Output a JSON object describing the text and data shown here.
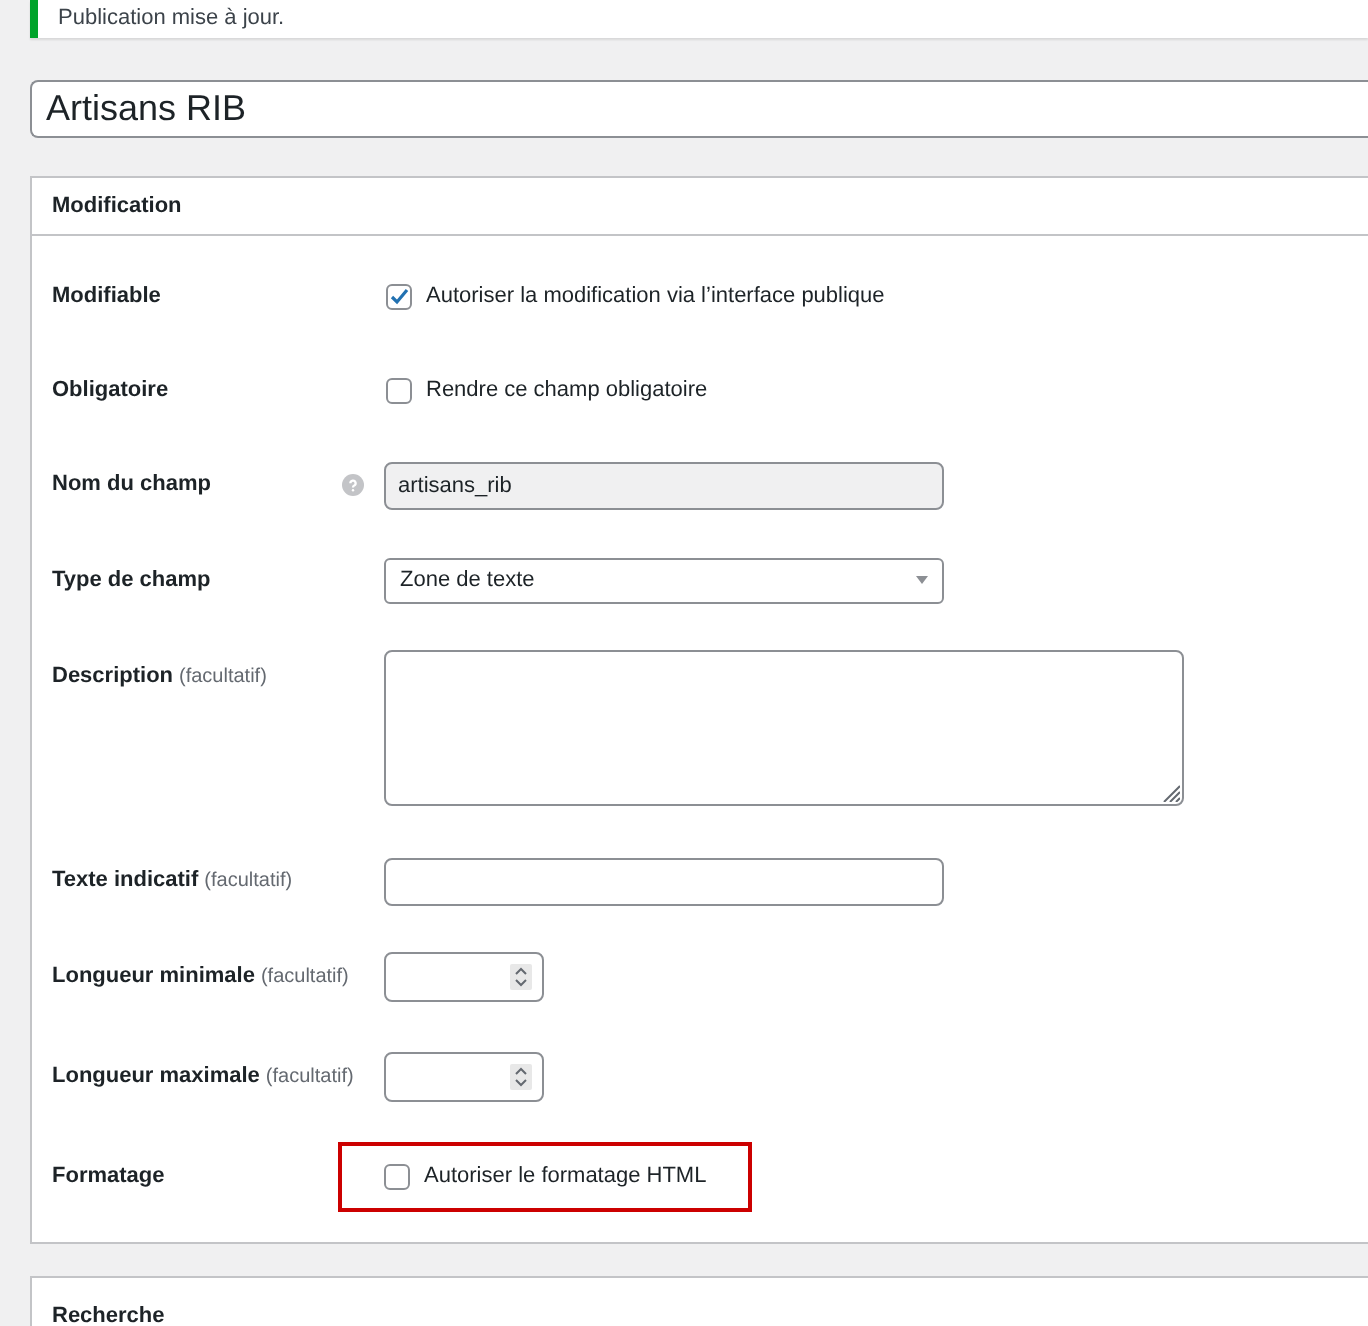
{
  "notice": {
    "text": "Publication mise à jour."
  },
  "title_field": {
    "value": "Artisans RIB"
  },
  "panel": {
    "title": "Modification",
    "rows": [
      {
        "kind": "checkbox",
        "label": "Modifiable",
        "checked": true,
        "text": "Autoriser la modification via l’interface publique",
        "highlighted": false
      },
      {
        "kind": "checkbox",
        "label": "Obligatoire",
        "checked": false,
        "text": "Rendre ce champ obligatoire",
        "highlighted": false
      },
      {
        "kind": "readonly",
        "label": "Nom du champ",
        "value": "artisans_rib"
      },
      {
        "kind": "select",
        "label": "Type de champ",
        "value": "Zone de texte"
      },
      {
        "kind": "textarea",
        "label": "Description",
        "optional": "(facultatif)"
      },
      {
        "kind": "text",
        "label": "Texte indicatif",
        "optional": "(facultatif)"
      },
      {
        "kind": "number",
        "label": "Longueur minimale",
        "optional": "(facultatif)"
      },
      {
        "kind": "number",
        "label": "Longueur maximale",
        "optional": "(facultatif)"
      },
      {
        "kind": "checkbox",
        "label": "Formatage",
        "checked": false,
        "text": "Autoriser le formatage HTML",
        "highlighted": true
      }
    ]
  },
  "next_panel": {
    "title": "Recherche"
  }
}
